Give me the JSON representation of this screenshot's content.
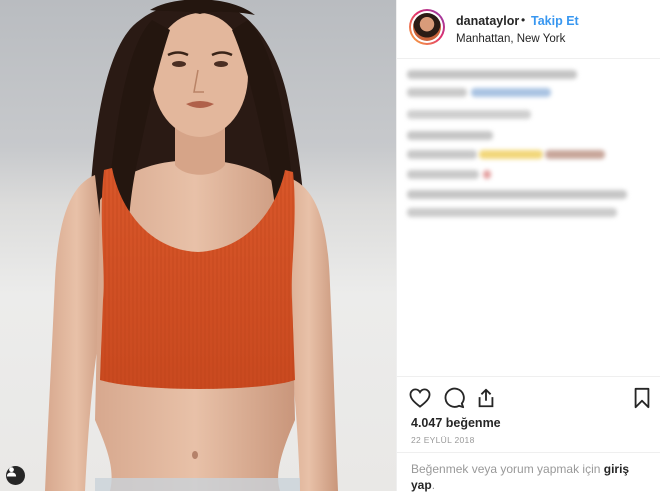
{
  "post": {
    "username": "danataylor",
    "separator": "•",
    "follow_label": "Takip Et",
    "location": "Manhattan, New York",
    "likes": "4.047 beğenme",
    "date": "22 EYLÜL 2018",
    "login_prompt": "Beğenmek veya yorum yapmak için",
    "login_link": "giriş yap",
    "login_suffix": "."
  },
  "icons": {
    "like": "heart-icon",
    "comment": "comment-bubble-icon",
    "share": "share-icon",
    "save": "bookmark-icon",
    "tagged": "user-tag-icon"
  },
  "colors": {
    "link": "#3897f0",
    "text": "#262626",
    "muted": "#999999",
    "divider": "#efefef",
    "top_color": "#d9572a"
  }
}
